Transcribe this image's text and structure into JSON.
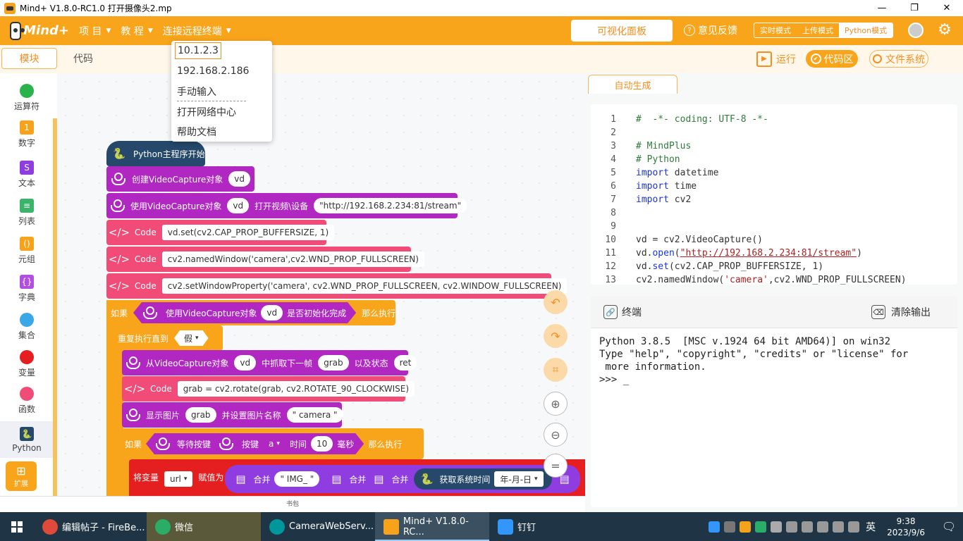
{
  "window": {
    "title": "Mind+ V1.8.0-RC1.0    打开摄像头2.mp"
  },
  "menubar": {
    "logo": "Mind+",
    "items": [
      {
        "label": "项 目"
      },
      {
        "label": "教 程"
      },
      {
        "label": "连接远程终端"
      }
    ],
    "viz_panel": "可视化面板",
    "feedback": "意见反馈",
    "modes": [
      {
        "label": "实时模式"
      },
      {
        "label": "上传模式"
      },
      {
        "label": "Python模式"
      }
    ]
  },
  "dropdown": {
    "items": [
      "10.1.2.3",
      "192.168.2.186",
      "手动输入",
      "打开网络中心",
      "帮助文档"
    ]
  },
  "tabs": {
    "blocks": "模块",
    "code": "代码"
  },
  "toolbar": {
    "run": "运行",
    "code_area": "代码区",
    "file_system": "文件系统"
  },
  "categories": [
    {
      "label": "运算符",
      "color": "#2ab34a"
    },
    {
      "label": "数字",
      "color": "#f7a21b"
    },
    {
      "label": "文本",
      "color": "#8f3ce0"
    },
    {
      "label": "列表",
      "color": "#3ab36b"
    },
    {
      "label": "元组",
      "color": "#f7a21b"
    },
    {
      "label": "字典",
      "color": "#b24fe0"
    },
    {
      "label": "集合",
      "color": "#3aa7e8"
    },
    {
      "label": "变量",
      "color": "#e51f1f"
    },
    {
      "label": "函数",
      "color": "#f14b77"
    },
    {
      "label": "Python",
      "color": "#25486b"
    }
  ],
  "ext": "扩展",
  "bookbag": "书包",
  "blocks": {
    "hat": "Python主程序开始",
    "b1": {
      "pre": "创建VideoCapture对象",
      "var": "vd"
    },
    "b2": {
      "pre": "使用VideoCapture对象",
      "var": "vd",
      "mid": "打开视频\\设备",
      "url": "\"http://192.168.2.234:81/stream\""
    },
    "code_label": "Code",
    "c1": "vd.set(cv2.CAP_PROP_BUFFERSIZE, 1)",
    "c2": "cv2.namedWindow('camera',cv2.WND_PROP_FULLSCREEN)",
    "c3": "cv2.setWindowProperty('camera', cv2.WND_PROP_FULLSCREEN, cv2.WINDOW_FULLSCREEN)",
    "if": "如果",
    "then": "那么执行",
    "cond1": {
      "pre": "使用VideoCapture对象",
      "var": "vd",
      "post": "是否初始化完成"
    },
    "repeat": "重复执行直到",
    "false": "假",
    "grab": {
      "pre": "从VideoCapture对象",
      "var": "vd",
      "mid": "中抓取下一帧",
      "v2": "grab",
      "mid2": "以及状态",
      "v3": "ret"
    },
    "c4": "grab = cv2.rotate(grab, cv2.ROTATE_90_CLOCKWISE)",
    "show": {
      "pre": "显示图片",
      "var": "grab",
      "mid": "并设置图片名称",
      "name": "\" camera \""
    },
    "wait": {
      "pre": "等待按键",
      "key_label": "按键",
      "key": "a",
      "time_label": "时间",
      "time": "10",
      "unit": "毫秒"
    },
    "setvar": {
      "pre": "将变量",
      "var": "url",
      "mid": "赋值为",
      "join": "合并",
      "img": "\" IMG_ \"",
      "time_label": "获取系统时间",
      "fmt": "年-月-日"
    }
  },
  "right": {
    "autogen": "自动生成",
    "code_lines": [
      {
        "n": "1",
        "parts": [
          {
            "t": "#  -*- coding: UTF-8 -*-",
            "c": "cm"
          }
        ]
      },
      {
        "n": "2",
        "parts": []
      },
      {
        "n": "3",
        "parts": [
          {
            "t": "# MindPlus",
            "c": "cm"
          }
        ]
      },
      {
        "n": "4",
        "parts": [
          {
            "t": "# Python",
            "c": "cm"
          }
        ]
      },
      {
        "n": "5",
        "parts": [
          {
            "t": "import",
            "c": "kw"
          },
          {
            "t": " datetime",
            "c": ""
          }
        ]
      },
      {
        "n": "6",
        "parts": [
          {
            "t": "import",
            "c": "kw"
          },
          {
            "t": " time",
            "c": ""
          }
        ]
      },
      {
        "n": "7",
        "parts": [
          {
            "t": "import",
            "c": "kw"
          },
          {
            "t": " cv2",
            "c": ""
          }
        ]
      },
      {
        "n": "8",
        "parts": []
      },
      {
        "n": "9",
        "parts": []
      },
      {
        "n": "10",
        "parts": [
          {
            "t": "vd = cv2.VideoCapture()",
            "c": ""
          }
        ]
      },
      {
        "n": "11",
        "parts": [
          {
            "t": "vd.",
            "c": ""
          },
          {
            "t": "open",
            "c": "kw"
          },
          {
            "t": "(",
            "c": ""
          },
          {
            "t": "\"http://192.168.2.234:81/stream\"",
            "c": "str"
          },
          {
            "t": ")",
            "c": ""
          }
        ]
      },
      {
        "n": "12",
        "parts": [
          {
            "t": "vd.",
            "c": ""
          },
          {
            "t": "set",
            "c": "kw"
          },
          {
            "t": "(cv2.CAP_PROP_BUFFERSIZE, 1)",
            "c": ""
          }
        ]
      },
      {
        "n": "13",
        "parts": [
          {
            "t": "cv2.namedWindow(",
            "c": ""
          },
          {
            "t": "'camera'",
            "c": "strq"
          },
          {
            "t": ",cv2.WND_PROP_FULLSCREEN)",
            "c": ""
          }
        ]
      }
    ],
    "terminal_title": "终端",
    "clear": "清除输出",
    "terminal_output": "Python 3.8.5  [MSC v.1924 64 bit AMD64)] on win32\nType \"help\", \"copyright\", \"credits\" or \"license\" for\n more information.\n>>> _"
  },
  "taskbar": {
    "items": [
      {
        "label": "编辑帖子 - FireBe...",
        "color": "#e04a3b"
      },
      {
        "label": "微信",
        "color": "#2aae67"
      },
      {
        "label": "CameraWebServ...",
        "color": "#00979c"
      },
      {
        "label": "Mind+ V1.8.0-RC...",
        "color": "#f7a21b"
      },
      {
        "label": "钉钉",
        "color": "#3296fa"
      }
    ],
    "ime": "英",
    "time": "9:38",
    "date": "2023/9/6"
  }
}
